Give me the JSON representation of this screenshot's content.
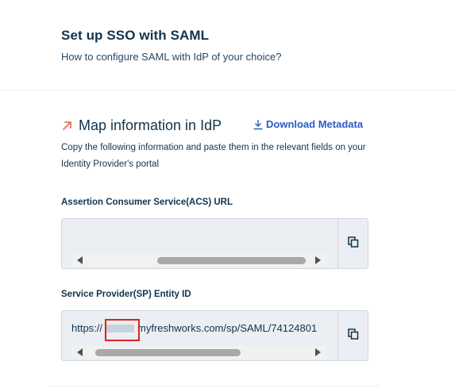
{
  "header": {
    "title": "Set up SSO with SAML",
    "subtitle": "How to configure SAML with IdP of your choice?"
  },
  "section": {
    "title": "Map information in IdP",
    "icon": "diagonal-arrow-icon",
    "download_label": "Download Metadata",
    "download_icon": "download-icon",
    "description": "Copy the following information and paste them in the relevant fields on your Identity Provider's portal"
  },
  "fields": {
    "acs": {
      "label": "Assertion Consumer Service(ACS) URL",
      "value": "",
      "copy_icon": "copy-icon"
    },
    "sp": {
      "label": "Service Provider(SP) Entity ID",
      "value": "https://",
      "value_suffix": "myfreshworks.com/sp/SAML/74124801",
      "copy_icon": "copy-icon"
    }
  },
  "colors": {
    "accent": "#2c5cc5",
    "arrow": "#e8705f",
    "text": "#12344d",
    "field_bg": "#ebeef2",
    "highlight": "#e02020"
  }
}
